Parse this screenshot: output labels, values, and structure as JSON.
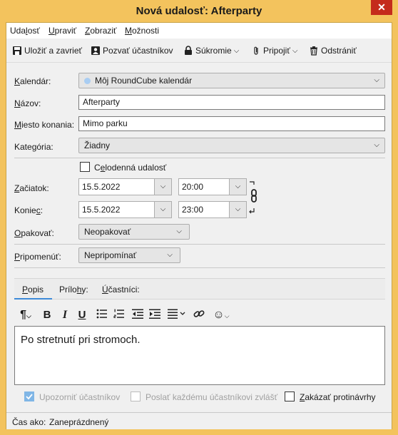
{
  "window": {
    "title": "Nová udalosť: Afterparty",
    "close_glyph": "✕"
  },
  "menubar": {
    "items": [
      {
        "pre": "Uda",
        "u": "l",
        "post": "osť"
      },
      {
        "pre": "",
        "u": "U",
        "post": "praviť"
      },
      {
        "pre": "",
        "u": "Z",
        "post": "obraziť"
      },
      {
        "pre": "",
        "u": "M",
        "post": "ožnosti"
      }
    ]
  },
  "toolbar": {
    "save_close": "Uložiť a zavrieť",
    "invite": "Pozvať účastníkov",
    "private": "Súkromie",
    "attach": "Pripojiť",
    "delete": "Odstrániť"
  },
  "form": {
    "calendar": {
      "label_u": "K",
      "label_rest": "alendár:",
      "value": "Môj RoundCube kalendár",
      "dot_color": "#a9cdf2"
    },
    "title": {
      "label_u": "N",
      "label_rest": "ázov:",
      "value": "Afterparty"
    },
    "location": {
      "label_u": "M",
      "label_rest": "iesto konania:",
      "value": "Mimo parku"
    },
    "category": {
      "label_pre": "Kate",
      "label_u": "g",
      "label_rest": "ória:",
      "value": "Žiadny"
    },
    "allday": {
      "pre": "C",
      "u": "e",
      "post": "lodenná udalosť",
      "checked": false
    },
    "start": {
      "label_u": "Z",
      "label_rest": "ačiatok:",
      "date": "15.5.2022",
      "time": "20:00"
    },
    "end": {
      "label_pre": "Konie",
      "label_u": "c",
      "label_rest": ":",
      "date": "15.5.2022",
      "time": "23:00"
    },
    "repeat": {
      "label_u": "O",
      "label_rest": "pakovať:",
      "value": "Neopakovať"
    },
    "remind": {
      "label_u": "P",
      "label_rest": "ripomenúť:",
      "value": "Nepripomínať"
    }
  },
  "tabs": [
    {
      "pre": "",
      "u": "P",
      "post": "opis",
      "active": true
    },
    {
      "pre": "Prílo",
      "u": "h",
      "post": "y:",
      "active": false
    },
    {
      "pre": "",
      "u": "Ú",
      "post": "častníci:",
      "active": false
    }
  ],
  "editor": {
    "text": "Po stretnutí pri stromoch."
  },
  "options": {
    "notify": {
      "label": "Upozorniť účastníkov",
      "checked": true,
      "disabled": true
    },
    "send_each": {
      "label": "Poslať každému účastníkovi zvlášť",
      "checked": false,
      "disabled": true
    },
    "disallow": {
      "pre": "",
      "u": "Z",
      "post": "akázať protinávrhy",
      "checked": false,
      "disabled": false
    }
  },
  "status": {
    "label": "Čas ako:",
    "value": "Zaneprázdnený"
  },
  "colors": {
    "titlebar": "#f3c35d",
    "close": "#c42b1c",
    "tab_accent": "#3d8ad8"
  }
}
